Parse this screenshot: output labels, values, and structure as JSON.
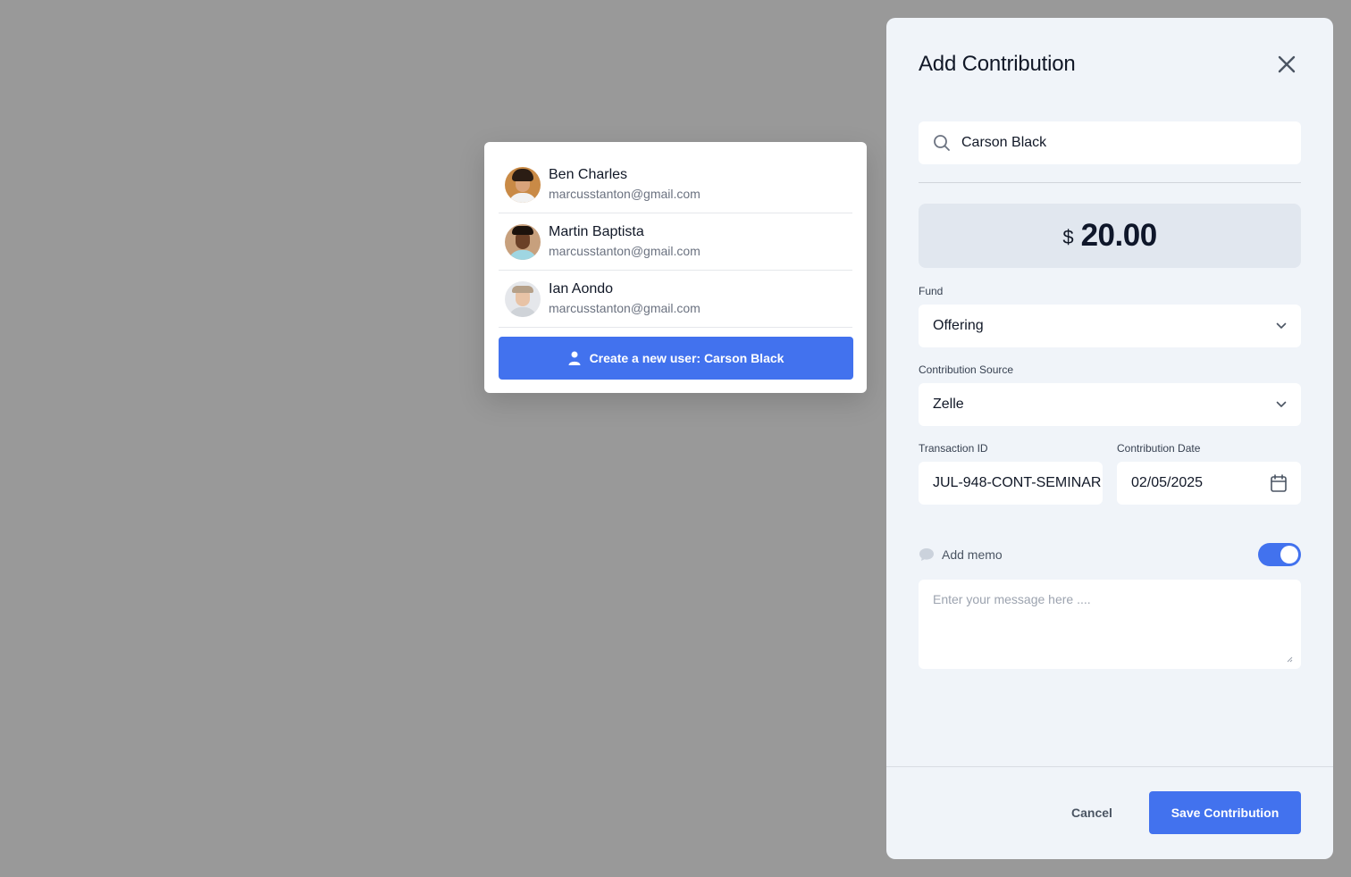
{
  "dropdown": {
    "users": [
      {
        "name": "Ben Charles",
        "email": "marcusstanton@gmail.com",
        "avatar": "avatar-ben-charles"
      },
      {
        "name": "Martin Baptista",
        "email": "marcusstanton@gmail.com",
        "avatar": "avatar-martin-baptista"
      },
      {
        "name": "Ian Aondo",
        "email": "marcusstanton@gmail.com",
        "avatar": "avatar-ian-aondo"
      }
    ],
    "create_label": "Create a new user: Carson Black",
    "create_icon": "user-icon"
  },
  "panel": {
    "title": "Add Contribution",
    "close_icon": "close-icon",
    "search": {
      "value": "Carson Black",
      "icon": "search-icon"
    },
    "amount": {
      "currency": "$",
      "value": "20.00"
    },
    "fund": {
      "label": "Fund",
      "value": "Offering"
    },
    "source": {
      "label": "Contribution Source",
      "value": "Zelle"
    },
    "transaction": {
      "label": "Transaction ID",
      "value": "JUL-948-CONT-SEMINAR"
    },
    "date": {
      "label": "Contribution Date",
      "value": "02/05/2025",
      "icon": "calendar-icon"
    },
    "memo": {
      "label": "Add memo",
      "enabled": true,
      "placeholder": "Enter your message here ....",
      "icon": "chat-bubble-icon"
    },
    "cancel_label": "Cancel",
    "save_label": "Save Contribution"
  },
  "colors": {
    "backdrop": "#999999",
    "panel_bg": "#f0f4f9",
    "accent": "#4272ee",
    "amount_bg": "#e1e7ef"
  }
}
